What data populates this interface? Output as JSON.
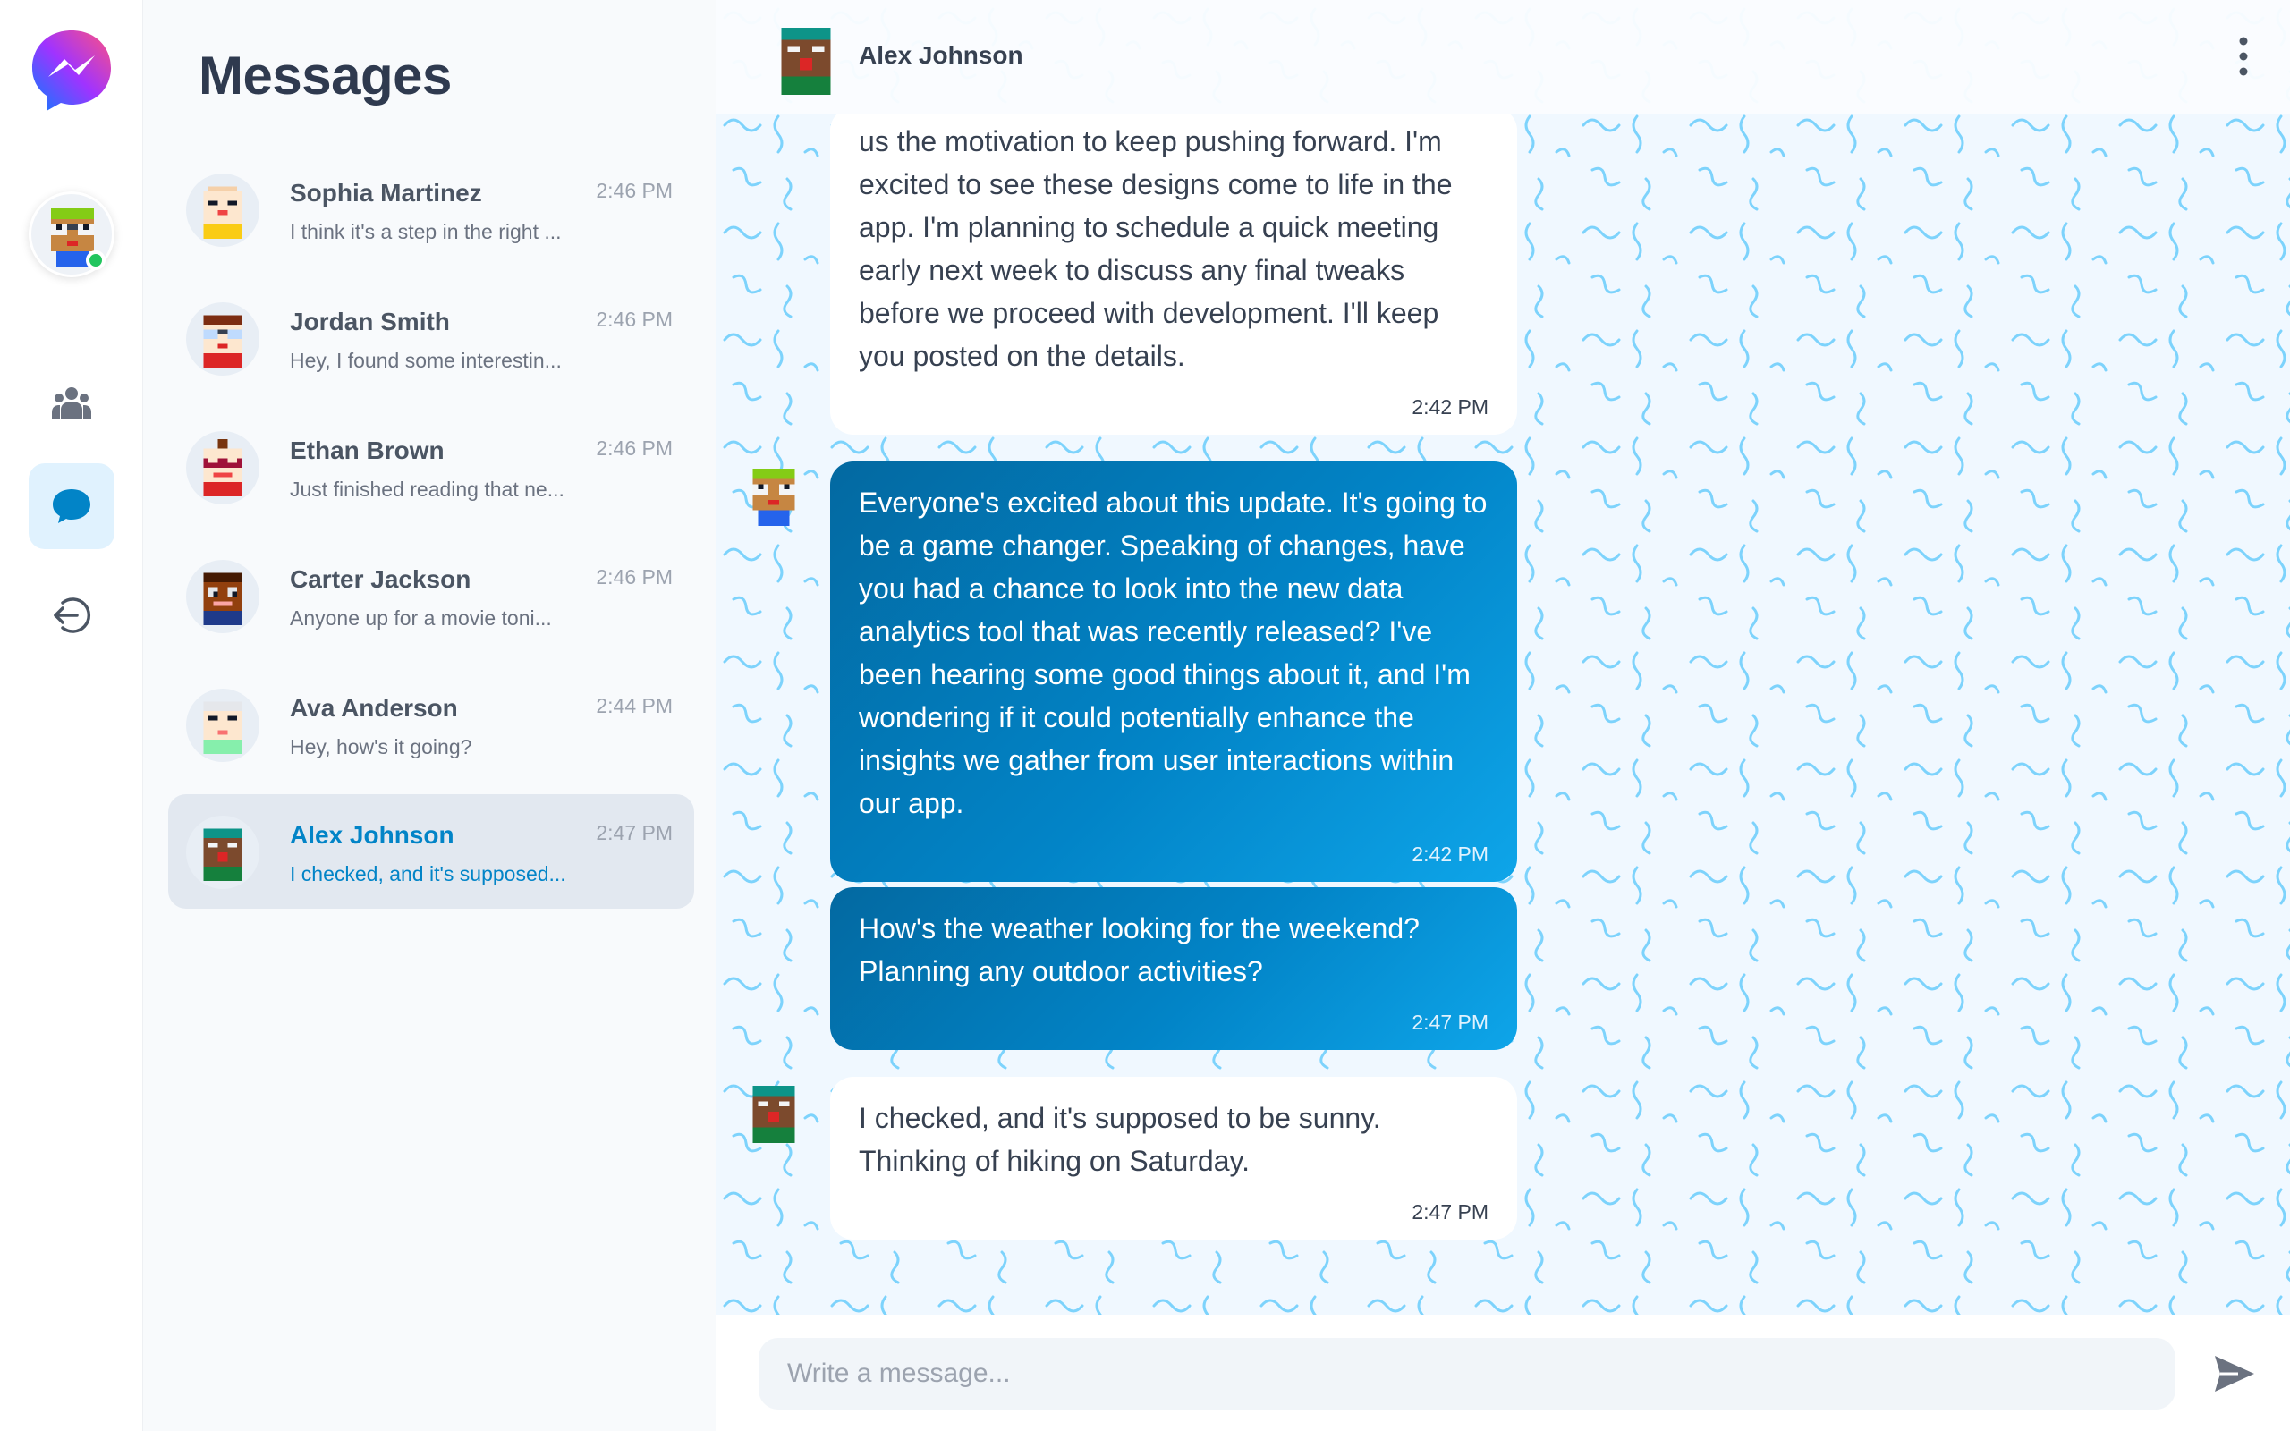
{
  "app": {
    "list_title": "Messages"
  },
  "rail": {
    "icons": [
      "messenger-logo-icon",
      "user-avatar",
      "people-icon",
      "chat-bubble-icon",
      "logout-icon"
    ],
    "active_item": "chats",
    "online_color": "#22c55e"
  },
  "conversations": [
    {
      "name": "Sophia Martinez",
      "time": "2:46 PM",
      "preview": "I think it's a step in the right ..."
    },
    {
      "name": "Jordan Smith",
      "time": "2:46 PM",
      "preview": "Hey, I found some interestin..."
    },
    {
      "name": "Ethan Brown",
      "time": "2:46 PM",
      "preview": "Just finished reading that ne..."
    },
    {
      "name": "Carter Jackson",
      "time": "2:46 PM",
      "preview": "Anyone up for a movie toni..."
    },
    {
      "name": "Ava Anderson",
      "time": "2:44 PM",
      "preview": "Hey, how's it going?"
    },
    {
      "name": "Alex Johnson",
      "time": "2:47 PM",
      "preview": "I checked, and it's supposed..."
    }
  ],
  "active_conversation": "Alex Johnson",
  "chat": {
    "header_name": "Alex Johnson",
    "messages": [
      {
        "direction": "in",
        "text": "us the motivation to keep pushing forward. I'm excited to see these designs come to life in the app. I'm planning to schedule a quick meeting early next week to discuss any final tweaks before we proceed with development. I'll keep you posted on the details.",
        "time": "2:42 PM"
      },
      {
        "direction": "out",
        "text": "Everyone's excited about this update. It's going to be a game changer. Speaking of changes, have you had a chance to look into the new data analytics tool that was recently released? I've been hearing some good things about it, and I'm wondering if it could potentially enhance the insights we gather from user interactions within our app.",
        "time": "2:42 PM"
      },
      {
        "direction": "out",
        "text": "How's the weather looking for the weekend? Planning any outdoor activities?",
        "time": "2:47 PM"
      },
      {
        "direction": "in",
        "text": "I checked, and it's supposed to be sunny. Thinking of hiking on Saturday.",
        "time": "2:47 PM"
      }
    ]
  },
  "composer": {
    "placeholder": "Write a message..."
  },
  "colors": {
    "accent": "#0284c7",
    "outgoing_bubble_start": "#0369a1",
    "outgoing_bubble_end": "#0ea5e9",
    "chat_background": "#f0f8ff",
    "pattern_stroke": "#7dd3fc"
  }
}
